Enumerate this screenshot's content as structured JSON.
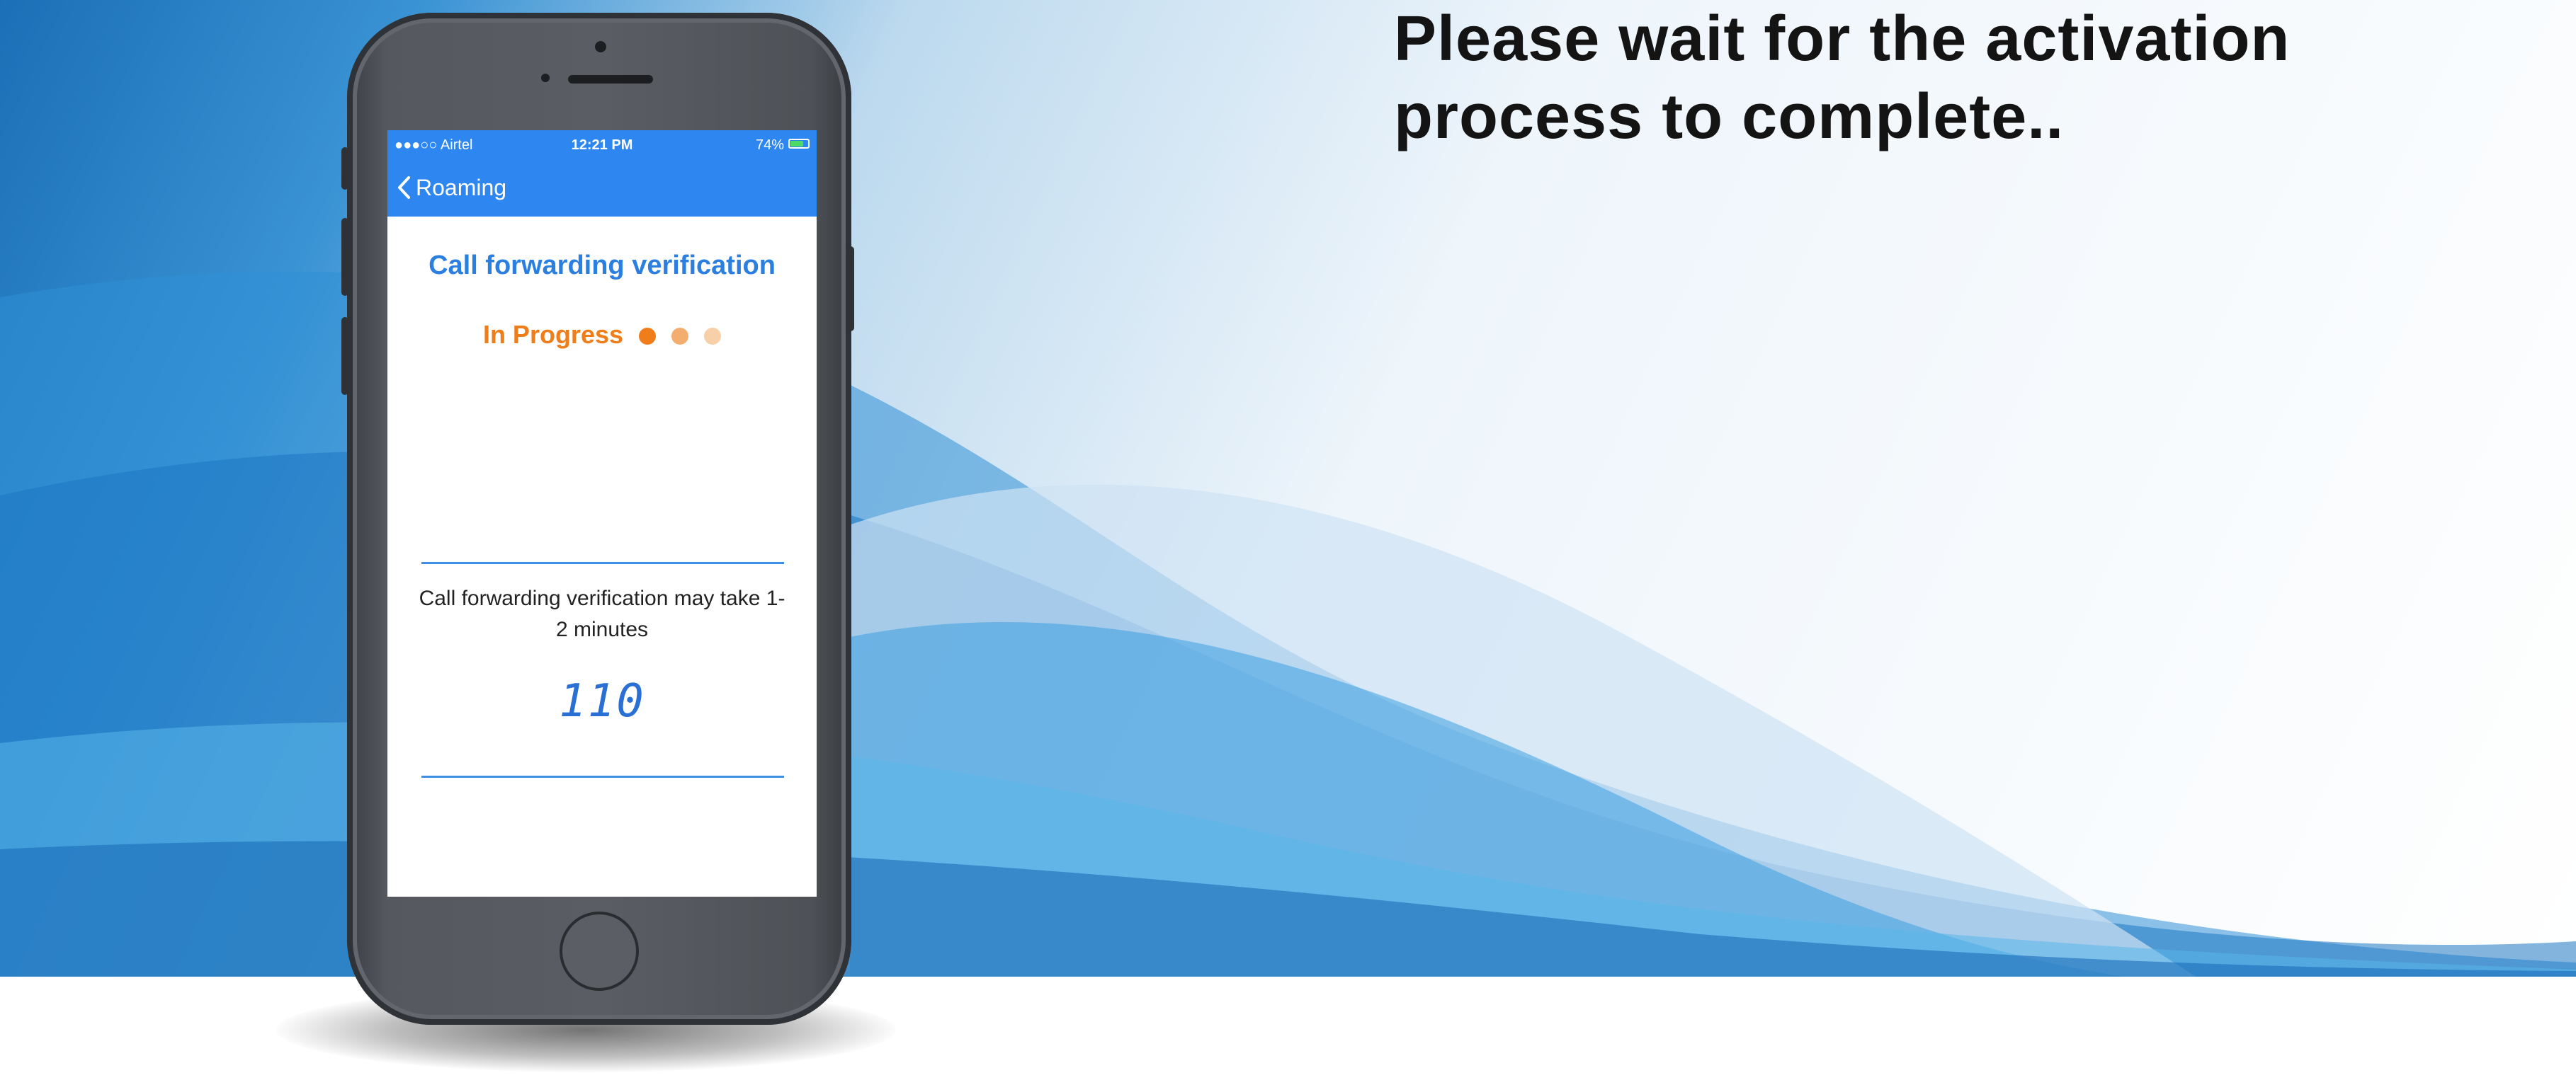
{
  "headline": {
    "line1": "Please wait for the activation",
    "line2": "process to complete.."
  },
  "status_bar": {
    "carrier": "●●●○○ Airtel",
    "time": "12:21 PM",
    "battery": "74%",
    "battery_level": 0.74
  },
  "nav_bar": {
    "back_label": "Roaming"
  },
  "verification": {
    "title": "Call forwarding verification",
    "status": "In Progress",
    "note": "Call forwarding verification may take 1-2 minutes",
    "countdown": "110"
  },
  "colors": {
    "nav_blue": "#2e86f0",
    "title_blue": "#2a7fe0",
    "progress_orange": "#ef7d1a",
    "dot_1": "#ef7d1a",
    "dot_2": "#f3ad6e",
    "dot_3": "#f7cfa8"
  }
}
